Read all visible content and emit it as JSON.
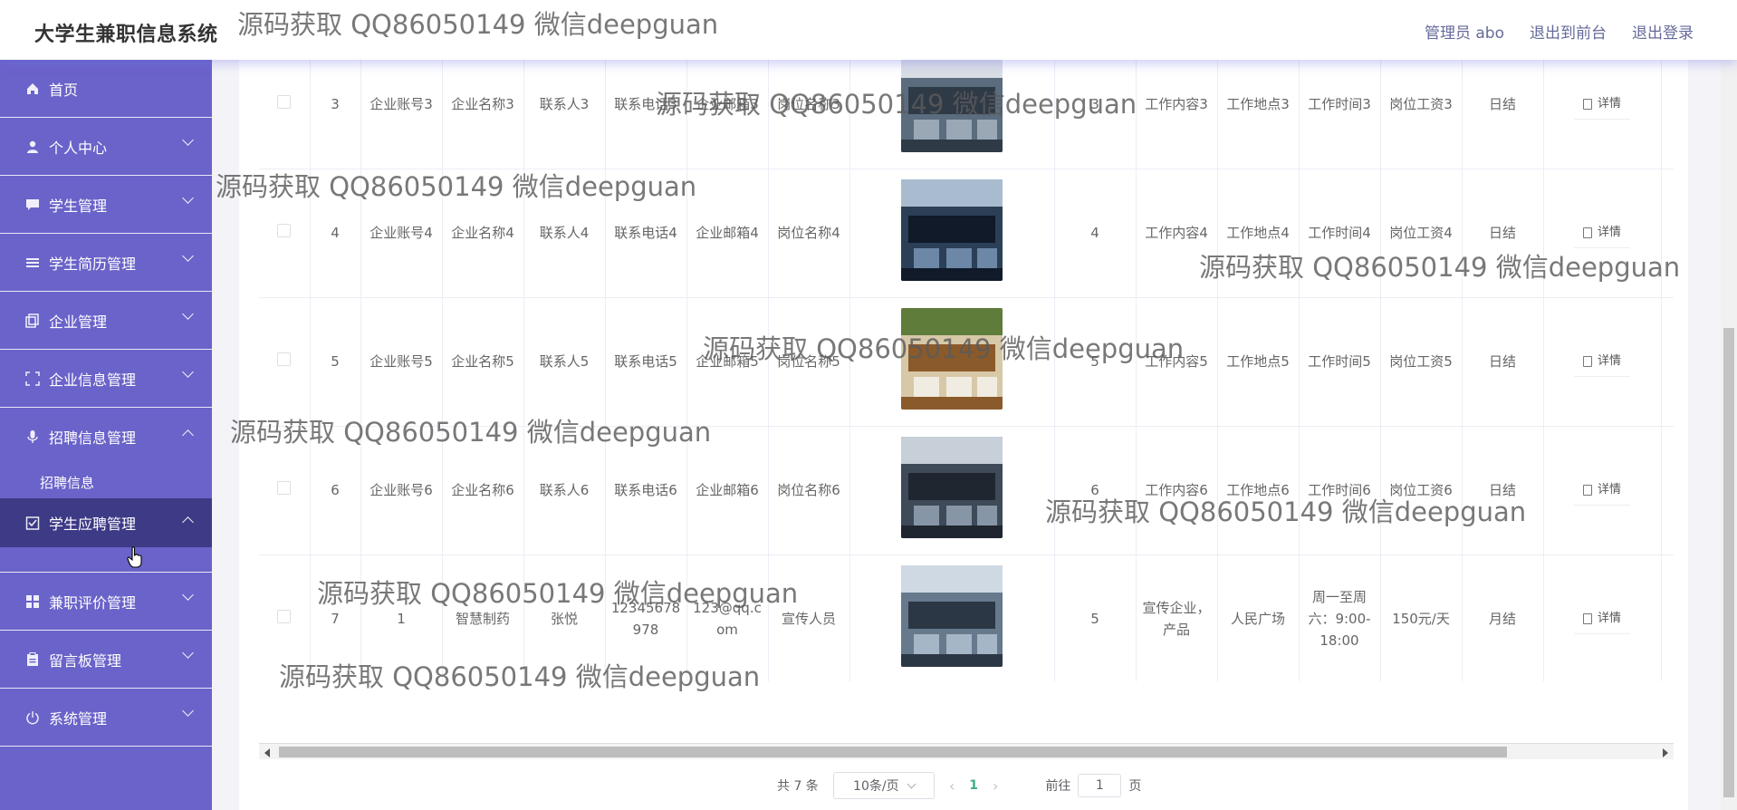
{
  "header": {
    "title": "大学生兼职信息系统",
    "links": [
      "管理员 abo",
      "退出到前台",
      "退出登录"
    ]
  },
  "sidebar": {
    "items": [
      {
        "label": "首页",
        "icon": "home-icon"
      },
      {
        "label": "个人中心",
        "icon": "user-icon"
      },
      {
        "label": "学生管理",
        "icon": "chat-icon"
      },
      {
        "label": "学生简历管理",
        "icon": "list-icon"
      },
      {
        "label": "企业管理",
        "icon": "copy-icon"
      },
      {
        "label": "企业信息管理",
        "icon": "frame-icon"
      },
      {
        "label": "招聘信息管理",
        "icon": "mic-icon"
      },
      {
        "label": "学生应聘管理",
        "icon": "checklist-icon"
      },
      {
        "label": "兼职评价管理",
        "icon": "grid-icon"
      },
      {
        "label": "留言板管理",
        "icon": "clipboard-icon"
      },
      {
        "label": "系统管理",
        "icon": "power-icon"
      }
    ],
    "submenu_recruit": "招聘信息"
  },
  "table": {
    "detail_label": "详情",
    "rows": [
      {
        "idx": "3",
        "account": "企业账号3",
        "name": "企业名称3",
        "contact": "联系人3",
        "phone": "联系电话3",
        "email": "企业邮箱3",
        "post": "岗位名称3",
        "count": "3",
        "content": "工作内容3",
        "place": "工作地点3",
        "time": "工作时间3",
        "wage": "岗位工资3",
        "settle": "日结"
      },
      {
        "idx": "4",
        "account": "企业账号4",
        "name": "企业名称4",
        "contact": "联系人4",
        "phone": "联系电话4",
        "email": "企业邮箱4",
        "post": "岗位名称4",
        "count": "4",
        "content": "工作内容4",
        "place": "工作地点4",
        "time": "工作时间4",
        "wage": "岗位工资4",
        "settle": "日结"
      },
      {
        "idx": "5",
        "account": "企业账号5",
        "name": "企业名称5",
        "contact": "联系人5",
        "phone": "联系电话5",
        "email": "企业邮箱5",
        "post": "岗位名称5",
        "count": "5",
        "content": "工作内容5",
        "place": "工作地点5",
        "time": "工作时间5",
        "wage": "岗位工资5",
        "settle": "日结"
      },
      {
        "idx": "6",
        "account": "企业账号6",
        "name": "企业名称6",
        "contact": "联系人6",
        "phone": "联系电话6",
        "email": "企业邮箱6",
        "post": "岗位名称6",
        "count": "6",
        "content": "工作内容6",
        "place": "工作地点6",
        "time": "工作时间6",
        "wage": "岗位工资6",
        "settle": "日结"
      },
      {
        "idx": "7",
        "account": "1",
        "name": "智慧制药",
        "contact": "张悦",
        "phone": "12345678978",
        "email": "123@qq.com",
        "post": "宣传人员",
        "count": "5",
        "content": "宣传企业，产品",
        "place": "人民广场",
        "time": "周一至周六：9:00-18:00",
        "wage": "150元/天",
        "settle": "月结"
      }
    ]
  },
  "pagination": {
    "total": "共 7 条",
    "page_size": "10条/页",
    "prev": "‹",
    "current": "1",
    "next": "›",
    "goto_prefix": "前往",
    "goto_value": "1",
    "goto_suffix": "页"
  },
  "watermark": "源码获取 QQ86050149 微信deepguan"
}
